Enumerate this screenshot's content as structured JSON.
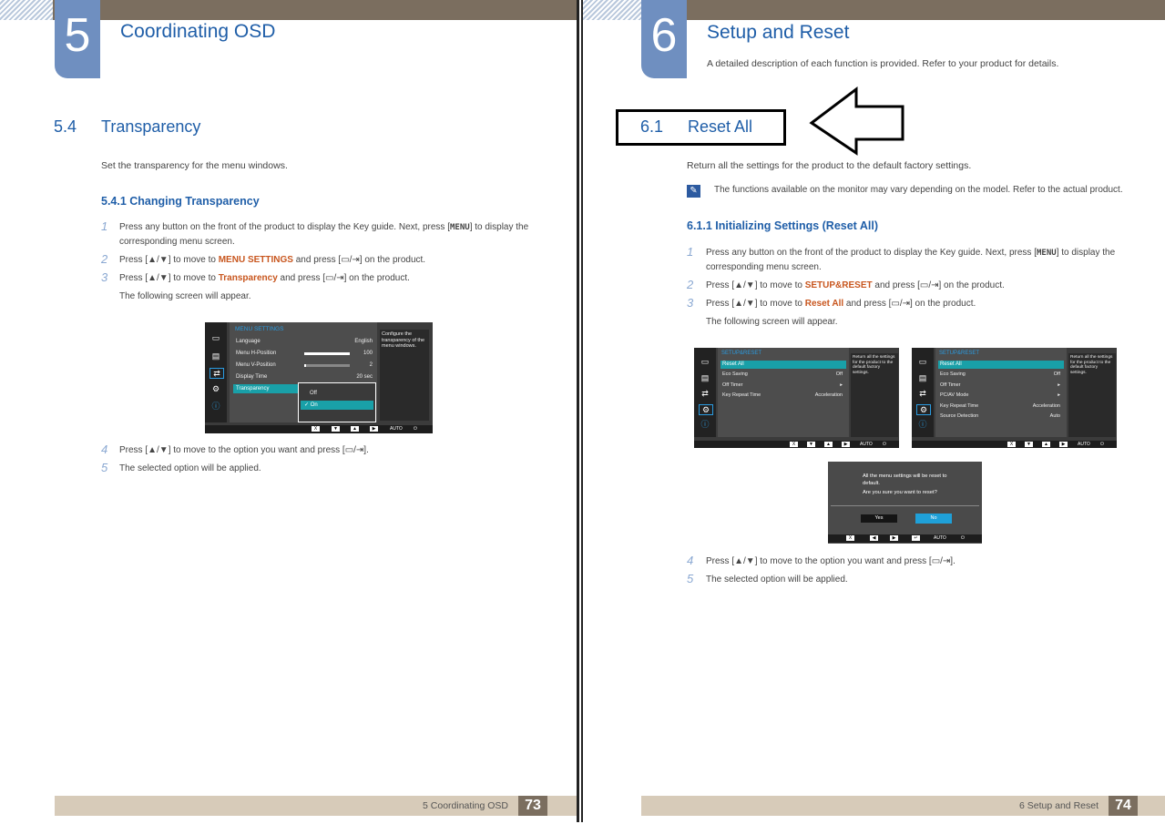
{
  "left_page": {
    "chapter_number": "5",
    "chapter_title": "Coordinating OSD",
    "section_number": "5.4",
    "section_title": "Transparency",
    "intro": "Set the transparency for the menu windows.",
    "subsection": "5.4.1   Changing Transparency",
    "steps": [
      {
        "num": "1",
        "pre": "Press any button on the front of the product to display the Key guide. Next, press [",
        "key": "MENU",
        "post": "] to display the corresponding menu screen."
      },
      {
        "num": "2",
        "pre": "Press [▲/▼] to move to ",
        "hl": "MENU SETTINGS",
        "post": " and press [▭/⇥] on the product."
      },
      {
        "num": "3",
        "pre": "Press [▲/▼] to move to ",
        "hl": "Transparency",
        "post": " and press [▭/⇥] on the product."
      },
      {
        "num": "",
        "pre": "The following screen will appear."
      },
      {
        "num": "4",
        "pre": "Press [▲/▼] to move to the option you want and press [▭/⇥]."
      },
      {
        "num": "5",
        "pre": "The selected option will be applied."
      }
    ],
    "osd": {
      "title": "MENU SETTINGS",
      "rows": [
        {
          "label": "Language",
          "value": "English"
        },
        {
          "label": "Menu H-Position",
          "value": "100",
          "level": 1.0
        },
        {
          "label": "Menu V-Position",
          "value": "2",
          "level": 0.02
        },
        {
          "label": "Display Time",
          "value": "20 sec"
        },
        {
          "label": "Transparency",
          "value": ""
        }
      ],
      "dropdown": [
        "Off",
        "✓ On"
      ],
      "help": "Configure the transparency of the menu windows.",
      "bar_buttons": [
        "X",
        "▼",
        "▲",
        "▶"
      ],
      "bar_auto": "AUTO",
      "bar_power": "⏻"
    },
    "footer_label": "5 Coordinating OSD",
    "page_number": "73"
  },
  "right_page": {
    "chapter_number": "6",
    "chapter_title": "Setup and Reset",
    "chapter_intro": "A detailed description of each function is provided. Refer to your product for details.",
    "section_number": "6.1",
    "section_title": "Reset All",
    "intro": "Return all the settings for the product to the default factory settings.",
    "note": "The functions available on the monitor may vary depending on the model. Refer to the actual product.",
    "subsection": "6.1.1   Initializing Settings (Reset All)",
    "steps": [
      {
        "num": "1",
        "pre": "Press any button on the front of the product to display the Key guide. Next, press [",
        "key": "MENU",
        "post": "] to display the corresponding menu screen."
      },
      {
        "num": "2",
        "pre": "Press [▲/▼] to move to ",
        "hl": "SETUP&RESET",
        "post": " and press [▭/⇥] on the product."
      },
      {
        "num": "3",
        "pre": "Press [▲/▼] to move to ",
        "hl": "Reset All",
        "post": " and press [▭/⇥] on the product."
      },
      {
        "num": "",
        "pre": "The following screen will appear."
      },
      {
        "num": "4",
        "pre": "Press [▲/▼] to move to the option you want and press [▭/⇥]."
      },
      {
        "num": "5",
        "pre": "The selected option will be applied."
      }
    ],
    "osd_a": {
      "title": "SETUP&RESET",
      "rows": [
        {
          "label": "Reset All",
          "value": ""
        },
        {
          "label": "Eco Saving",
          "value": "Off"
        },
        {
          "label": "Off Timer",
          "value": "▸"
        },
        {
          "label": "Key Repeat Time",
          "value": "Acceleration"
        }
      ],
      "help": "Return all the settings for the product to the default factory settings."
    },
    "osd_b": {
      "title": "SETUP&RESET",
      "rows": [
        {
          "label": "Reset All",
          "value": ""
        },
        {
          "label": "Eco Saving",
          "value": "Off"
        },
        {
          "label": "Off Timer",
          "value": "▸"
        },
        {
          "label": "PC/AV Mode",
          "value": "▸"
        },
        {
          "label": "Key Repeat Time",
          "value": "Acceleration"
        },
        {
          "label": "Source Detection",
          "value": "Auto"
        }
      ],
      "help": "Return all the settings for the product to the default factory settings."
    },
    "dialog": {
      "message": "All the menu settings will be reset to default.",
      "question": "Are you sure you want to reset?",
      "yes": "Yes",
      "no": "No",
      "bar_buttons": [
        "X",
        "◀",
        "▶",
        "↵"
      ],
      "bar_auto": "AUTO",
      "bar_power": "⏻"
    },
    "footer_label": "6 Setup and Reset",
    "page_number": "74"
  },
  "colors": {
    "topbar": "#7b6e5f",
    "chapter_tab": "#6f8fc0",
    "heading_blue": "#1f5ea8",
    "highlight_orange": "#c8561e",
    "osd_select": "#19a0a8",
    "footer_band": "#d7cbb9"
  }
}
